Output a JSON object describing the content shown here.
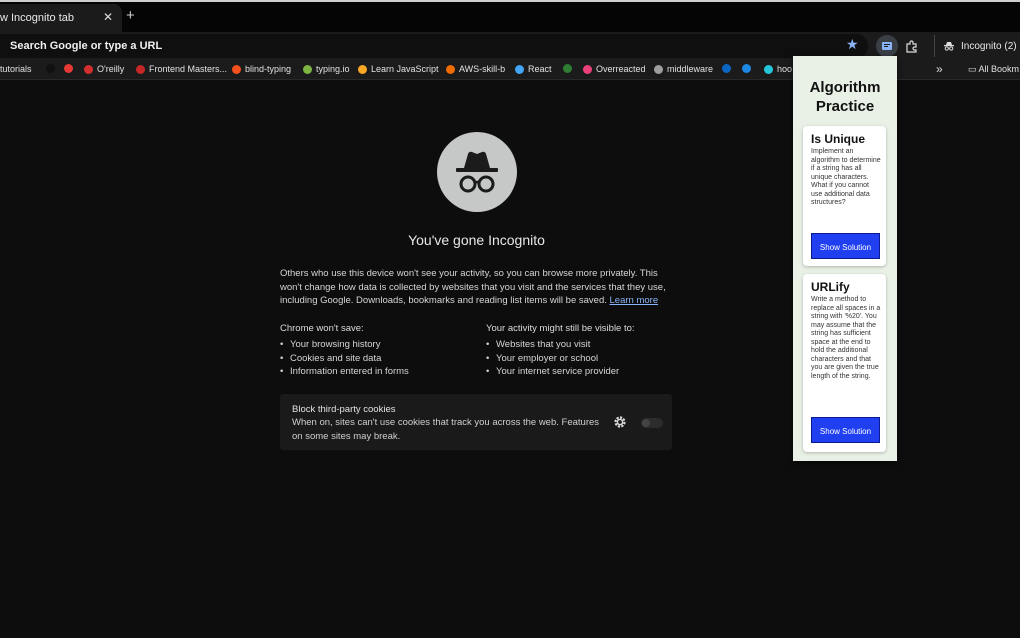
{
  "tab": {
    "title": "w Incognito tab",
    "close": "✕",
    "new_tab": "+"
  },
  "omnibox": {
    "text": "Search Google or type a URL"
  },
  "profile": {
    "label": "Incognito (2)"
  },
  "bookmarks": [
    {
      "label": "tutorials",
      "color": "#888888"
    },
    {
      "label": "",
      "color": "#111111"
    },
    {
      "label": "",
      "color": "#e53935"
    },
    {
      "label": "O'reilly",
      "color": "#d32f2f"
    },
    {
      "label": "Frontend Masters...",
      "color": "#c62828"
    },
    {
      "label": "blind-typing",
      "color": "#f4511e"
    },
    {
      "label": "typing.io",
      "color": "#7cb342"
    },
    {
      "label": "Learn JavaScript",
      "color": "#f9a825"
    },
    {
      "label": "AWS-skill-b",
      "color": "#ef6c00"
    },
    {
      "label": "React",
      "color": "#42a5f5"
    },
    {
      "label": "",
      "color": "#2e7d32"
    },
    {
      "label": "Overreacted",
      "color": "#ec407a"
    },
    {
      "label": "middleware",
      "color": "#9e9e9e"
    },
    {
      "label": "",
      "color": "#0a66c2"
    },
    {
      "label": "",
      "color": "#1e88e5"
    },
    {
      "label": "hoo",
      "color": "#26c6da"
    }
  ],
  "bookmarks_more": "»",
  "bookmarks_all": "All Bookm",
  "incognito": {
    "heading": "You've gone Incognito",
    "intro": "Others who use this device won't see your activity, so you can browse more privately. This won't change how data is collected by websites that you visit and the services that they use, including Google. Downloads, bookmarks and reading list items will be saved.",
    "learn_more": "Learn more",
    "wont_save_title": "Chrome won't save:",
    "wont_save": [
      "Your browsing history",
      "Cookies and site data",
      "Information entered in forms"
    ],
    "visible_title": "Your activity might still be visible to:",
    "visible": [
      "Websites that you visit",
      "Your employer or school",
      "Your internet service provider"
    ],
    "cookie_title": "Block third-party cookies",
    "cookie_desc": "When on, sites can't use cookies that track you across the web. Features on some sites may break."
  },
  "popup": {
    "title": "Algorithm Practice",
    "cards": [
      {
        "title": "Is Unique",
        "desc": "Implement an algorithm to determine if a string has all unique characters. What if you cannot use additional data structures?",
        "button": "Show Solution"
      },
      {
        "title": "URLify",
        "desc": "Write a method to replace all spaces in a string with '%20'. You may assume that the string has sufficient space at the end to hold the additional characters and that you are given the true length of the string.",
        "button": "Show Solution"
      }
    ]
  },
  "colors": {
    "accent_link": "#8ab4f8",
    "button_blue": "#1f3ff0",
    "popup_bg": "#e9f1e6"
  }
}
